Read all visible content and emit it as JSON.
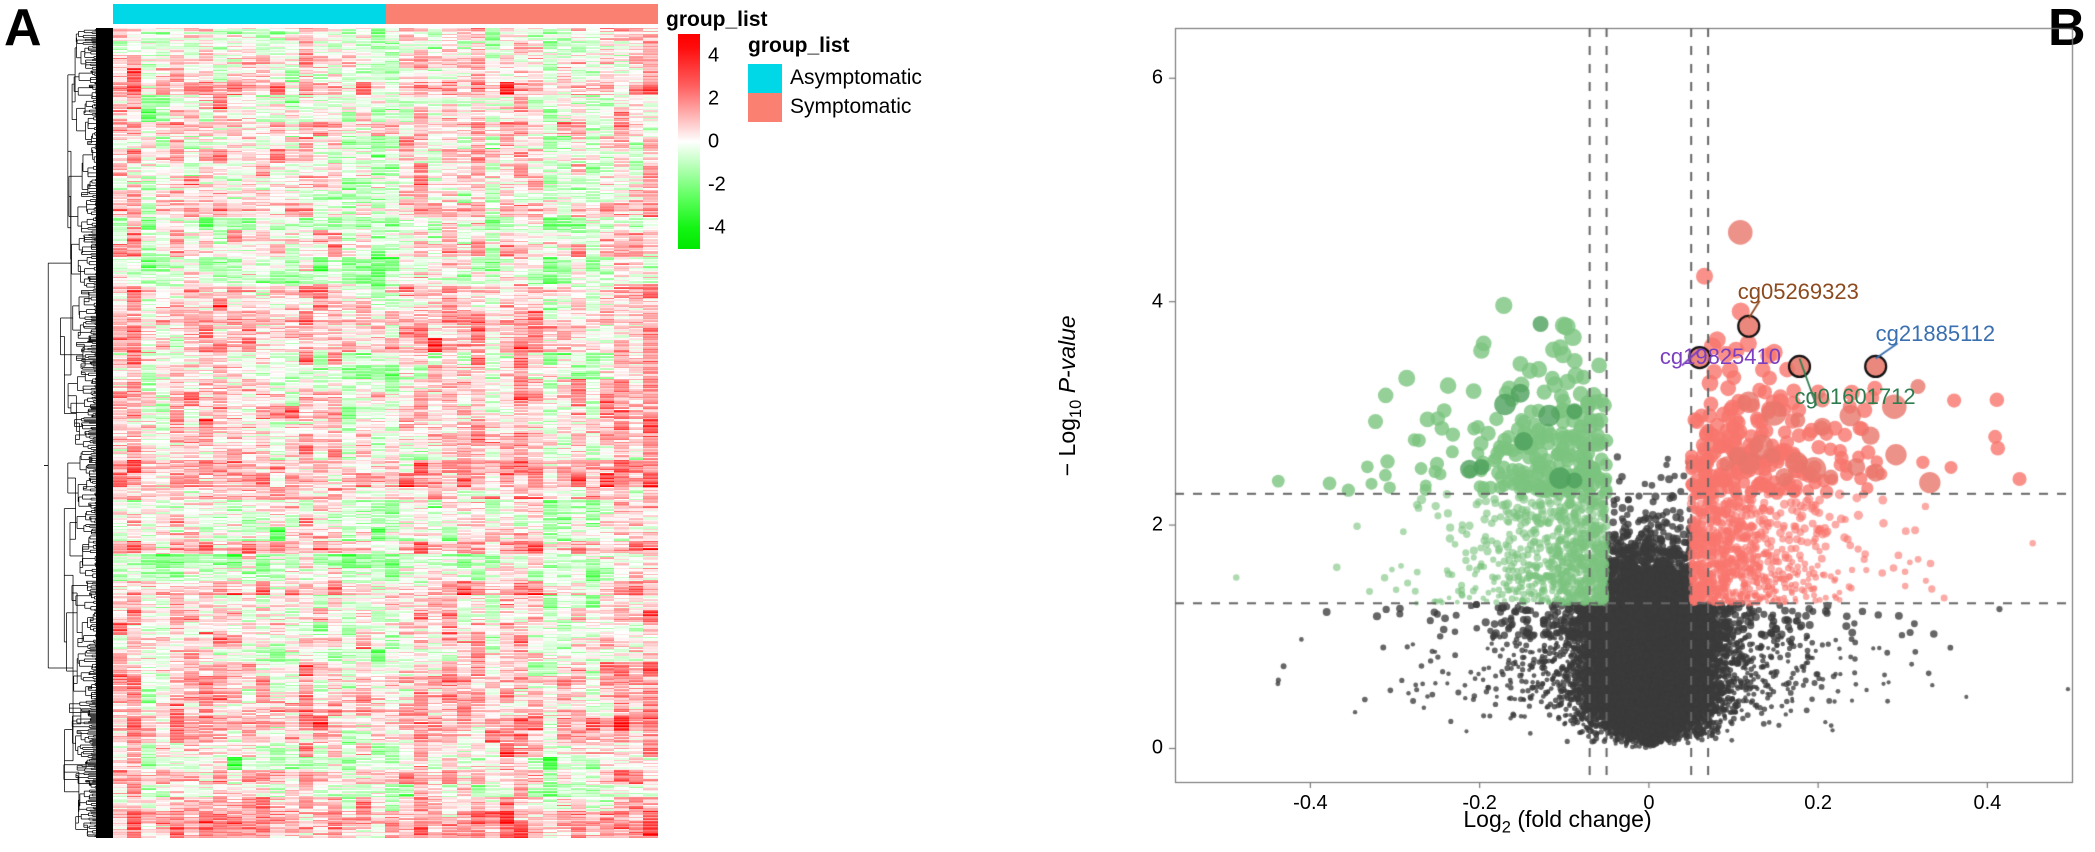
{
  "figure": {
    "panels": [
      {
        "letter": "A",
        "type": "heatmap"
      },
      {
        "letter": "B",
        "type": "volcano"
      }
    ]
  },
  "panelA": {
    "letter": "A",
    "annotation_title": "group_list",
    "legend_title": "group_list",
    "groups": [
      {
        "label": "Asymptomatic",
        "color": "#00d8e8",
        "fraction": 0.5
      },
      {
        "label": "Symptomatic",
        "color": "#fa8072",
        "fraction": 0.5
      }
    ],
    "colorbar": {
      "ticks": [
        "4",
        "2",
        "0",
        "-2",
        "-4"
      ],
      "tick_values": [
        4,
        2,
        0,
        -2,
        -4
      ],
      "vmin": -5,
      "vmax": 5,
      "high_color": "#ff0000",
      "mid_color": "#ffffff",
      "low_color": "#00e800"
    },
    "row_dendrogram": true,
    "row_annotation_color": "#000000",
    "n_columns": 38,
    "n_rows": 540
  },
  "panelB": {
    "letter": "B",
    "chart_data": {
      "type": "scatter",
      "title": "",
      "xlabel": "Log2 (fold change)",
      "ylabel": "- Log10 P-value",
      "xlabel_base": "Log",
      "xlabel_sub": "2",
      "xlabel_rest": " (fold change)",
      "ylabel_base": "− Log",
      "ylabel_sub": "10",
      "ylabel_rest": " P-value",
      "xlim": [
        -0.56,
        0.5
      ],
      "ylim": [
        -0.3,
        6.45
      ],
      "xticks": [
        -0.4,
        -0.2,
        0.0,
        0.2,
        0.4
      ],
      "xticklabels": [
        "-0.4",
        "-0.2",
        "0",
        "0.2",
        "0.4"
      ],
      "yticks": [
        0,
        2,
        4,
        6
      ],
      "yticklabels": [
        "0",
        "2",
        "4",
        "6"
      ],
      "grid": false,
      "legend": "none",
      "vlines": [
        -0.07,
        -0.05,
        0.05,
        0.07
      ],
      "hlines": [
        1.3,
        2.28
      ],
      "line_style": "dashed",
      "line_color": "#666666",
      "up_color": "#f8766d",
      "down_color": "#7cc47f",
      "ns_color": "#3b3b3b",
      "highlight_up_color": "#e8776b",
      "highlight_down_color": "#4ea05c",
      "annotations": [
        {
          "label": "cg05269323",
          "x": 0.118,
          "y": 3.78,
          "color": "#8c4a1e",
          "label_x": 0.105,
          "label_y": 4.08
        },
        {
          "label": "cg21885112",
          "x": 0.268,
          "y": 3.42,
          "color": "#3a6fb0",
          "label_x": 0.268,
          "label_y": 3.7
        },
        {
          "label": "cg19825410",
          "x": 0.06,
          "y": 3.5,
          "color": "#7b3fbf",
          "label_x": 0.013,
          "label_y": 3.5
        },
        {
          "label": "cg01601712",
          "x": 0.178,
          "y": 3.42,
          "color": "#2f7d4f",
          "label_x": 0.172,
          "label_y": 3.14
        }
      ]
    }
  }
}
